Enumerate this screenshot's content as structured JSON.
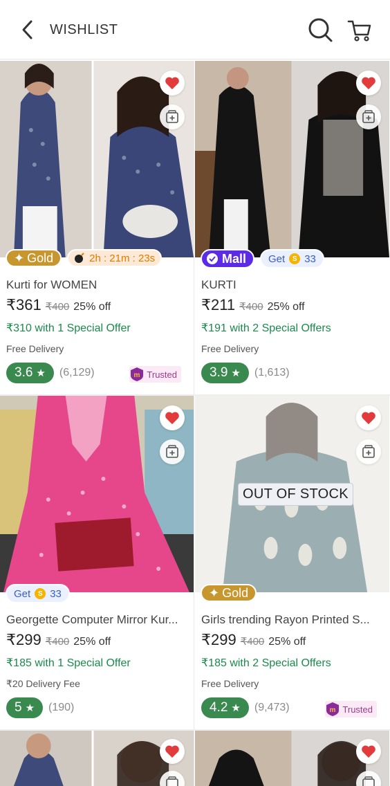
{
  "header": {
    "title": "WISHLIST"
  },
  "colors": {
    "gold": "#c8962e",
    "mall": "#5b2be5",
    "rating": "#3a8a50",
    "offer": "#1a8a4c",
    "heart": "#e23b3b"
  },
  "products": [
    {
      "name": "Kurti for WOMEN",
      "price": "₹361",
      "mrp": "₹400",
      "discount": "25% off",
      "offer": "₹310 with 1 Special Offer",
      "delivery": "Free Delivery",
      "rating": "3.6",
      "rating_count": "(6,129)",
      "trusted": "Trusted",
      "badges": {
        "gold": "Gold",
        "timer": "2h : 21m : 23s"
      }
    },
    {
      "name": "KURTI",
      "price": "₹211",
      "mrp": "₹400",
      "discount": "25% off",
      "offer": "₹191 with 2 Special Offers",
      "delivery": "Free Delivery",
      "rating": "3.9",
      "rating_count": "(1,613)",
      "badges": {
        "mall": "Mall",
        "coin_prefix": "Get",
        "coins": "33"
      }
    },
    {
      "name": "Georgette Computer Mirror Kur...",
      "price": "₹299",
      "mrp": "₹400",
      "discount": "25% off",
      "offer": "₹185 with 1 Special Offer",
      "delivery": "₹20 Delivery Fee",
      "rating": "5",
      "rating_count": "(190)",
      "badges": {
        "coin_prefix": "Get",
        "coins": "33"
      }
    },
    {
      "name": "Girls trending Rayon Printed S...",
      "price": "₹299",
      "mrp": "₹400",
      "discount": "25% off",
      "offer": "₹185 with 2 Special Offers",
      "delivery": "Free Delivery",
      "rating": "4.2",
      "rating_count": "(9,473)",
      "trusted": "Trusted",
      "stock_label": "OUT OF STOCK",
      "badges": {
        "gold": "Gold"
      }
    }
  ]
}
